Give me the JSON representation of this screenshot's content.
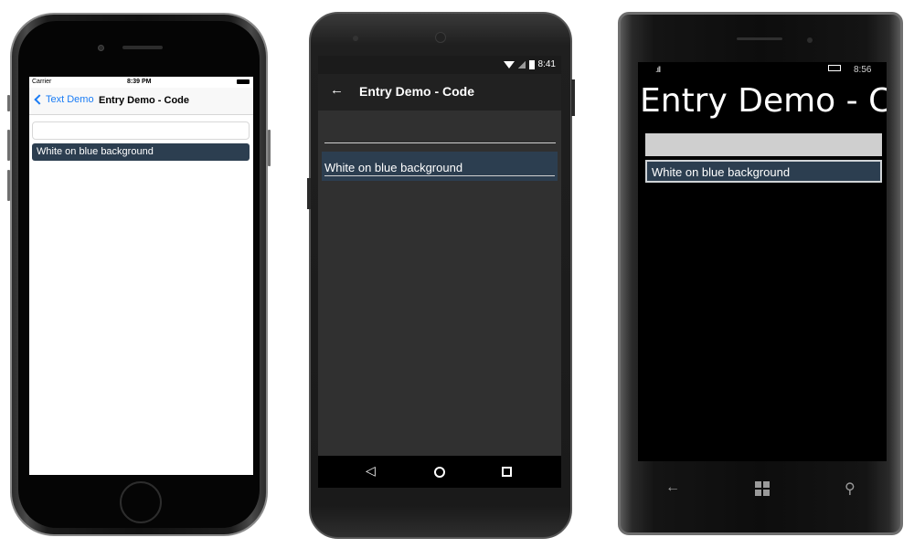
{
  "ios": {
    "status": {
      "carrier": "Carrier",
      "time": "8:39 PM"
    },
    "nav": {
      "back_label": "Text Demo",
      "title": "Entry Demo - Code"
    },
    "entry_blue": {
      "text": "White on blue background"
    }
  },
  "android": {
    "status": {
      "time": "8:41"
    },
    "toolbar": {
      "back_icon": "←",
      "title": "Entry Demo - Code"
    },
    "entry_blue": {
      "text": "White on blue background"
    },
    "navbar": {
      "back": "◁"
    }
  },
  "winphone": {
    "status": {
      "signal": ".ıll",
      "time": "8:56"
    },
    "page_title": "Entry Demo - Code",
    "entry_blue": {
      "text": "White on blue background"
    },
    "navbar": {
      "back": "←",
      "search": "⚲"
    }
  },
  "colors": {
    "entry_background": "#2c3e50",
    "ios_accent": "#1a7cf5",
    "android_background": "#303030"
  }
}
